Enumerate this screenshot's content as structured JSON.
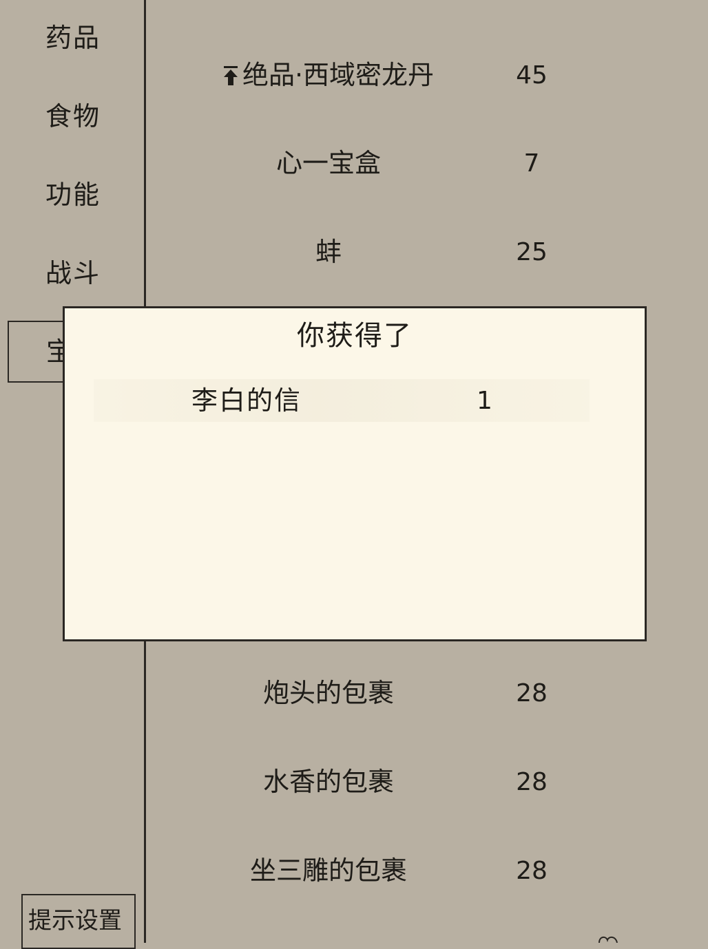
{
  "sidebar": {
    "categories": [
      "药品",
      "食物",
      "功能",
      "战斗"
    ],
    "active_category_partial": "宝",
    "hint_settings_label": "提示设置"
  },
  "items": [
    {
      "name": "绝品·西域密龙丹",
      "qty": "45",
      "pinned": true,
      "icon": "pin-top-icon"
    },
    {
      "name": "心一宝盒",
      "qty": "7"
    },
    {
      "name": "蚌",
      "qty": "25"
    },
    {
      "name": "炮头的包裹",
      "qty": "28"
    },
    {
      "name": "水香的包裹",
      "qty": "28"
    },
    {
      "name": "坐三雕的包裹",
      "qty": "28"
    }
  ],
  "modal": {
    "title": "你获得了",
    "item_name": "李白的信",
    "item_qty": "1"
  },
  "colors": {
    "background": "#b8b0a2",
    "modal_background": "#fcf7e8",
    "ink": "#1e1c18"
  }
}
